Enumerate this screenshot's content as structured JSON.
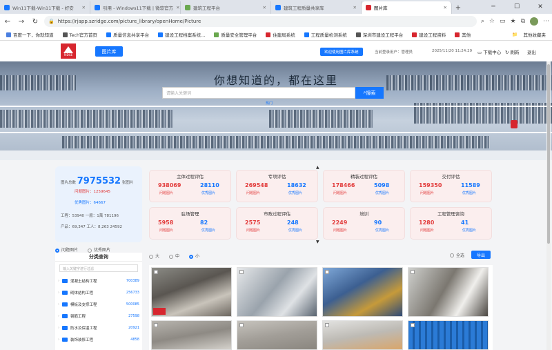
{
  "browser": {
    "tabs": [
      {
        "label": "Win11下载-Win11下载 - 好安",
        "color": "#1677ff"
      },
      {
        "label": "引用 - Windows11下载 | 微软官方",
        "color": "#1677ff"
      },
      {
        "label": "建筑工程平台",
        "color": "#6aa84f"
      },
      {
        "label": "建筑工程质量共享库",
        "color": "#1677ff"
      },
      {
        "label": "图片库",
        "color": "#d7262e"
      }
    ],
    "url": "https://rjapp.szridge.com/picture_library/openHome/Picture",
    "bookmarks": [
      {
        "label": "百度一下，你就知道",
        "color": "#4a7fe0"
      },
      {
        "label": "Tech官方首页",
        "color": "#555"
      },
      {
        "label": "质量信息共享平台",
        "color": "#1677ff"
      },
      {
        "label": "建设工程档案系统...",
        "color": "#1677ff"
      },
      {
        "label": "质量安全管理平台",
        "color": "#6aa84f"
      },
      {
        "label": "住建局系统",
        "color": "#d7262e"
      },
      {
        "label": "工程质量检测系统",
        "color": "#1677ff"
      },
      {
        "label": "深圳市建设工程平台",
        "color": "#555"
      },
      {
        "label": "建设工程资料",
        "color": "#d7262e"
      },
      {
        "label": "其他",
        "color": "#d7262e"
      }
    ],
    "bookmarks_right": "其他收藏夹"
  },
  "header": {
    "home_button": "图片库",
    "pill": "欢迎使用图片库系统",
    "info1": "当前登录用户：管理员",
    "datetime": "2025/11/20 11:24:29",
    "link1": "下载中心",
    "link2": "刷新",
    "link3": "退出"
  },
  "hero": {
    "title": "你想知道的，都在这里",
    "search_placeholder": "请输入关键词",
    "search_button": "搜索",
    "corner_text": "热门"
  },
  "stats": {
    "total_label": "图片总数",
    "total_value": "7975532",
    "total_unit": "张图片",
    "line1": "问题图片：1259645",
    "line2": "优秀图片：64667",
    "line3": "工程：53940  一般：1萬  781196",
    "line4": "产品：69,347  工人：8,263  24592"
  },
  "cards": [
    {
      "title": "主体过程评估",
      "problem": "938069",
      "good": "28110"
    },
    {
      "title": "专项评估",
      "problem": "269548",
      "good": "18632"
    },
    {
      "title": "精装过程评估",
      "problem": "178466",
      "good": "5098"
    },
    {
      "title": "交付评估",
      "problem": "159350",
      "good": "11589"
    },
    {
      "title": "驻场管理",
      "problem": "5958",
      "good": "82"
    },
    {
      "title": "市政过程评估",
      "problem": "2575",
      "good": "248"
    },
    {
      "title": "培训",
      "problem": "2249",
      "good": "90"
    },
    {
      "title": "工程管理咨询",
      "problem": "1280",
      "good": "41"
    }
  ],
  "card_labels": {
    "problem": "问题图片",
    "good": "优秀图片"
  },
  "filters": {
    "radio1": "问题图片",
    "radio2": "优秀图片",
    "size_large": "大",
    "size_medium": "中",
    "size_small": "小",
    "select_all": "全选",
    "export": "导出"
  },
  "side": {
    "header": "分类查询",
    "search_placeholder": "输入关键字进行过滤",
    "categories": [
      {
        "label": "混凝土结构工程",
        "count": "700389"
      },
      {
        "label": "砌体结构工程",
        "count": "256733"
      },
      {
        "label": "模板及支撑工程",
        "count": "500085"
      },
      {
        "label": "钢筋工程",
        "count": "27598"
      },
      {
        "label": "防水及保温工程",
        "count": "20921"
      },
      {
        "label": "装饰装修工程",
        "count": "4858"
      }
    ]
  }
}
